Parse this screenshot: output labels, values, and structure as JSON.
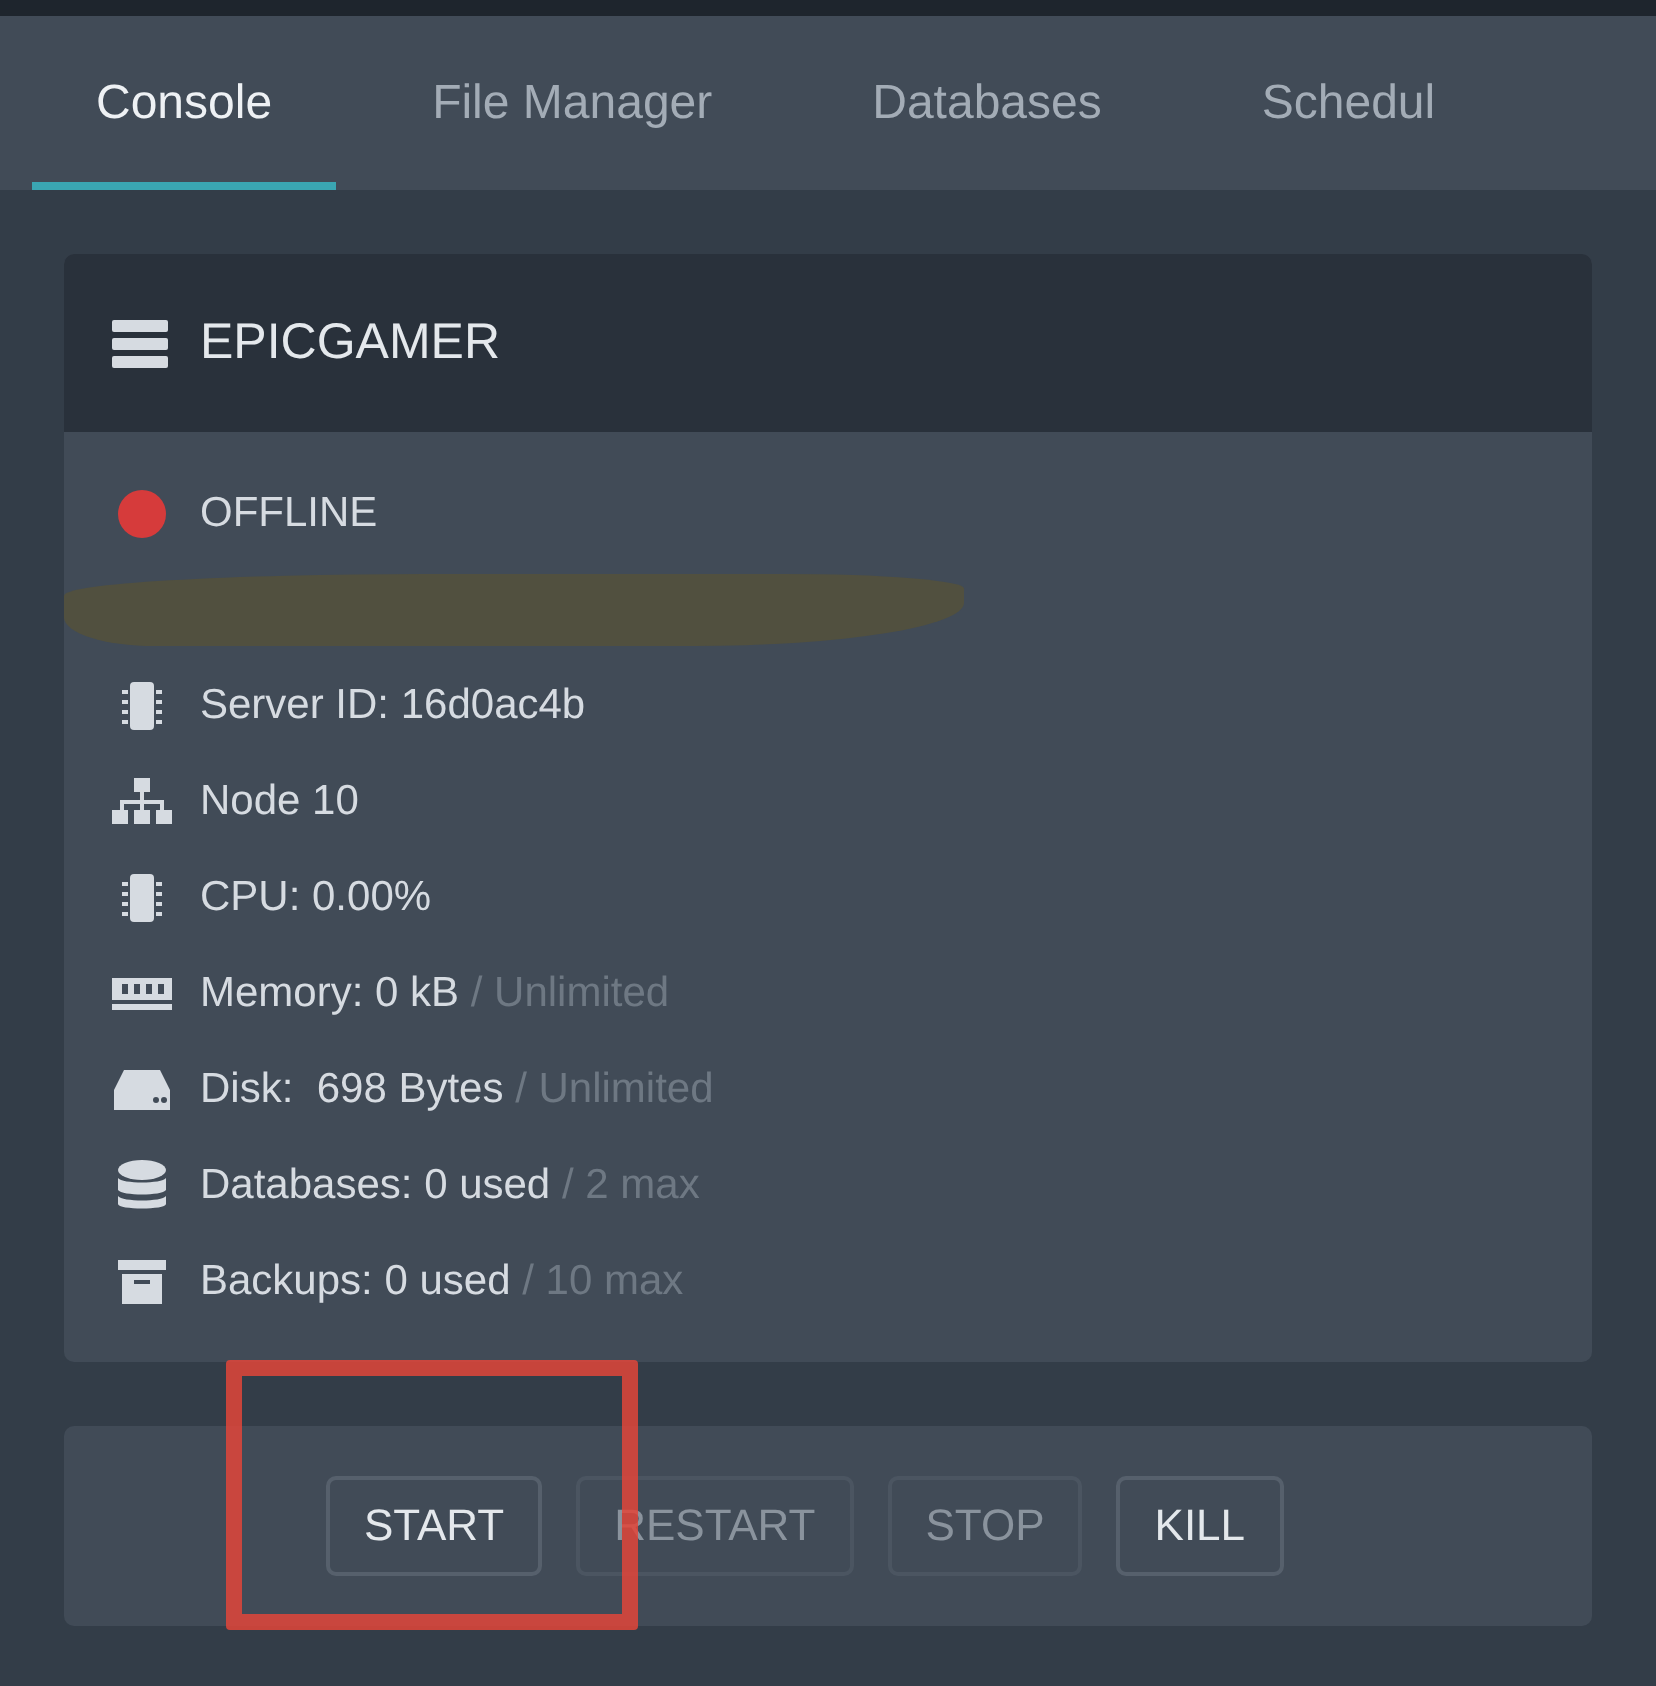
{
  "tabs": [
    {
      "label": "Console",
      "selected": true
    },
    {
      "label": "File Manager",
      "selected": false
    },
    {
      "label": "Databases",
      "selected": false
    },
    {
      "label": "Schedul",
      "selected": false
    }
  ],
  "server": {
    "name": "EPICGAMER",
    "stats": [
      {
        "kind": "status",
        "color": "#d63b3b",
        "text": "OFFLINE"
      },
      {
        "kind": "redacted"
      },
      {
        "kind": "chip",
        "text": "Server ID: 16d0ac4b"
      },
      {
        "kind": "network",
        "text": "Node 10"
      },
      {
        "kind": "chip",
        "text": "CPU: 0.00%"
      },
      {
        "kind": "memory",
        "text": "Memory: 0 kB",
        "limit": "/ Unlimited"
      },
      {
        "kind": "disk",
        "text": "Disk:  698 Bytes",
        "limit": "/ Unlimited"
      },
      {
        "kind": "database",
        "text": "Databases: 0 used",
        "limit": "/ 2 max"
      },
      {
        "kind": "archive",
        "text": "Backups: 0 used",
        "limit": "/ 10 max"
      }
    ]
  },
  "controls": [
    {
      "label": "START",
      "disabled": false
    },
    {
      "label": "RESTART",
      "disabled": true
    },
    {
      "label": "STOP",
      "disabled": true
    },
    {
      "label": "KILL",
      "disabled": false
    }
  ]
}
